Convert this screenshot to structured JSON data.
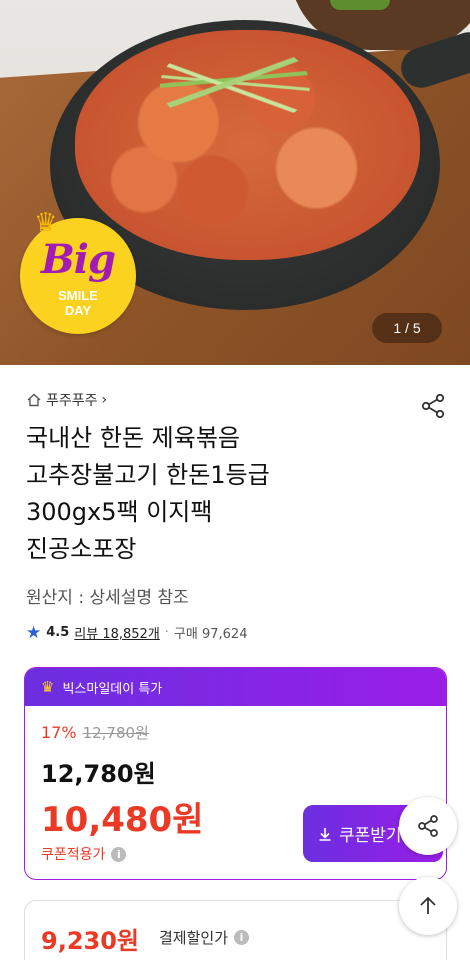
{
  "hero": {
    "badge": {
      "big": "Big",
      "smile": "SMILE",
      "day": "DAY"
    },
    "pager": {
      "current": "1",
      "separator": "/",
      "total": "5"
    }
  },
  "product": {
    "store_name": "푸주푸주",
    "store_chevron": "›",
    "title_lines": [
      "국내산 한돈 제육볶음",
      "고추장불고기 한돈1등급",
      "300gx5팩 이지팩",
      "진공소포장"
    ],
    "origin": "원산지 : 상세설명 참조",
    "rating": "4.5",
    "reviews": "리뷰 18,852개",
    "separator": "·",
    "purchases": "구매 97,624"
  },
  "deal": {
    "header": "빅스마일데이 특가",
    "discount": "17%",
    "original_price": "12,780원",
    "price": "12,780원",
    "final_price": "10,480원",
    "coupon_label": "쿠폰적용가",
    "coupon_button": "쿠폰받기",
    "info_icon": "i"
  },
  "payment": {
    "price": "9,230원",
    "label": "결제할인가",
    "info_icon": "i"
  },
  "colors": {
    "accent_purple": "#9a1ee6",
    "price_red": "#ea3a25",
    "star_blue": "#2a62d4",
    "badge_yellow": "#fbd21f"
  },
  "icons": [
    "home-icon",
    "share-icon",
    "star-icon",
    "crown-icon",
    "info-icon",
    "download-icon",
    "arrow-up-icon"
  ]
}
